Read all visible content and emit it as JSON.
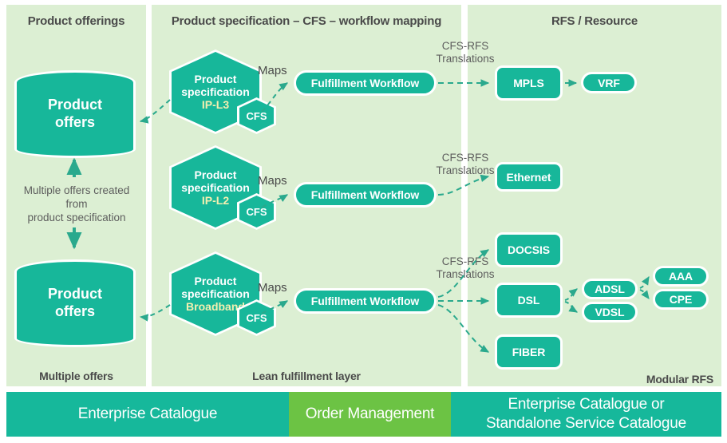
{
  "columns": [
    {
      "title": "Product offerings",
      "footer": "Multiple offers"
    },
    {
      "title": "Product specification – CFS – workflow mapping",
      "footer": "Lean fulfillment layer"
    },
    {
      "title": "RFS / Resource",
      "footer": "Modular RFS"
    }
  ],
  "product_offers": {
    "top_label": "Product\noffers",
    "top_line1": "Product",
    "top_line2": "offers",
    "bottom_line1": "Product",
    "bottom_line2": "offers",
    "note": "Multiple offers created from\nproduct specification",
    "note_line1": "Multiple offers created",
    "note_line2": "from",
    "note_line3": "product specification"
  },
  "rows": [
    {
      "spec_line1": "Product",
      "spec_line2": "specification",
      "spec_accent": "IP-L3",
      "cfs_label": "CFS",
      "maps_label": "Maps",
      "workflow_label": "Fulfillment Workflow",
      "translations_line1": "CFS-RFS",
      "translations_line2": "Translations",
      "resources": [
        "MPLS"
      ],
      "sub_resources": [
        "VRF"
      ]
    },
    {
      "spec_line1": "Product",
      "spec_line2": "specification",
      "spec_accent": "IP-L2",
      "cfs_label": "CFS",
      "maps_label": "Maps",
      "workflow_label": "Fulfillment Workflow",
      "translations_line1": "CFS-RFS",
      "translations_line2": "Translations",
      "resources": [
        "Ethernet"
      ],
      "sub_resources": []
    },
    {
      "spec_line1": "Product",
      "spec_line2": "specification",
      "spec_accent": "Broadband",
      "cfs_label": "CFS",
      "maps_label": "Maps",
      "workflow_label": "Fulfillment Workflow",
      "translations_line1": "CFS-RFS",
      "translations_line2": "Translations",
      "resources": [
        "DOCSIS",
        "DSL",
        "FIBER"
      ],
      "sub_resources": [
        "ADSL",
        "VDSL"
      ],
      "leaf_resources": [
        "AAA",
        "CPE"
      ]
    }
  ],
  "bottom_bar": {
    "segments": [
      {
        "label": "Enterprise Catalogue",
        "color": "#16b89b"
      },
      {
        "label": "Order Management",
        "color": "#6cc344"
      },
      {
        "label": "Enterprise Catalogue or\nStandalone Service Catalogue",
        "color": "#16b89b",
        "line1": "Enterprise Catalogue or",
        "line2": "Standalone Service Catalogue"
      }
    ]
  },
  "colors": {
    "teal": "#17b79a",
    "panel": "#dcefd3",
    "accent_yellow": "#f4efb0",
    "green": "#6cc344",
    "text_gray": "#4a4a4a",
    "arrow": "#2aa98d"
  }
}
